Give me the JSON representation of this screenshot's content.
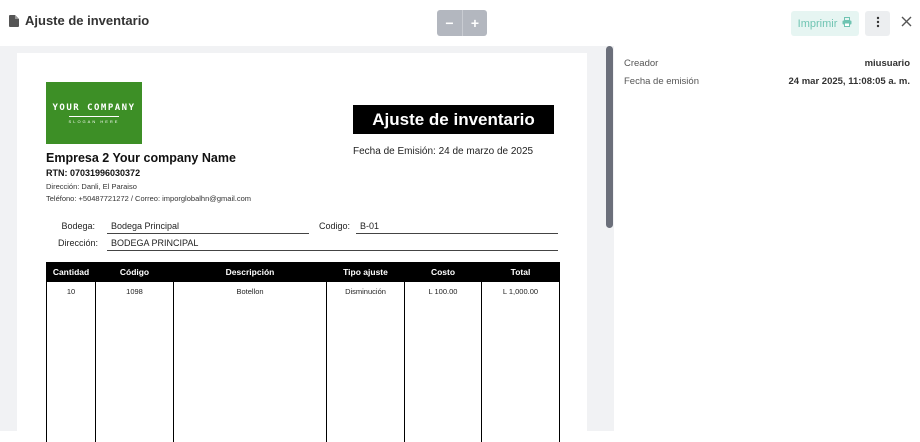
{
  "header": {
    "title": "Ajuste de inventario",
    "zoom_out_label": "−",
    "zoom_in_label": "+",
    "print_label": "Imprimir",
    "more_icon": "kebab-menu-icon",
    "close_icon": "close-icon",
    "accent_color": "#6fc4b2"
  },
  "document": {
    "logo": {
      "company": "YOUR COMPANY",
      "slogan": "SLOGAN HERE",
      "color": "#3d8f26"
    },
    "company_name": "Empresa 2 Your company Name",
    "rtn": "RTN: 07031996030372",
    "address": "Dirección: Danli, El Paraiso",
    "contact": "Teléfono: +50487721272 / Correo: imporglobalhn@gmail.com",
    "doc_title": "Ajuste de inventario",
    "emission": "Fecha de Emisión: 24 de marzo de 2025",
    "fields": {
      "bodega_label": "Bodega:",
      "bodega_value": "Bodega Principal",
      "codigo_label": "Codigo:",
      "codigo_value": "B-01",
      "direccion_label": "Dirección:",
      "direccion_value": "BODEGA PRINCIPAL"
    },
    "table": {
      "columns": [
        "Cantidad",
        "Código",
        "Descripción",
        "Tipo ajuste",
        "Costo",
        "Total"
      ],
      "rows": [
        [
          "10",
          "1098",
          "Botellon",
          "Disminución",
          "L 100.00",
          "L 1,000.00"
        ]
      ]
    }
  },
  "sidebar": {
    "creator_label": "Creador",
    "creator_value": "miusuario",
    "date_label": "Fecha de emisión",
    "date_value": "24 mar 2025, 11:08:05 a. m."
  }
}
